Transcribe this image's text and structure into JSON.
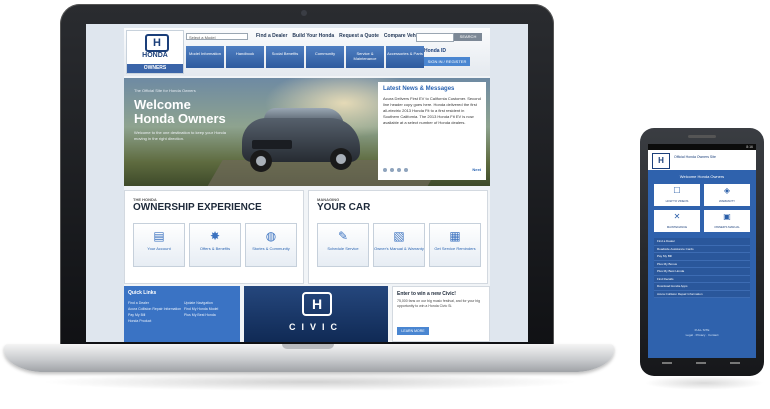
{
  "site": {
    "brand": "HONDA",
    "brand_sub": "OWNERS",
    "selector": "Select a Model",
    "top_links": [
      "Find a Dealer",
      "Build Your Honda",
      "Request a Quote",
      "Compare Vehicles"
    ],
    "search_button": "SEARCH",
    "nav": [
      "Model Information",
      "Handbook",
      "Social Benefits",
      "Community",
      "Service & Maintenance",
      "Accessories & Parts"
    ],
    "honda_id": "Honda ID",
    "register": "SIGN IN / REGISTER",
    "hero": {
      "eyebrow": "The Official Site for Honda Owners",
      "title": "Welcome Honda Owners",
      "desc": "Welcome to the one destination to keep your Honda moving in the right direction."
    },
    "news": {
      "title": "Latest News & Messages",
      "body": "Acura Delivers First EV to California Customer. Second line header copy goes here. Honda delivered the first all-electric 2013 Honda Fit to a first resident in Southern California. The 2013 Honda Fit EV is now available at a select number of Honda dealers.",
      "next": "Next"
    },
    "ownership": {
      "small": "THE HONDA",
      "big": "OWNERSHIP EXPERIENCE",
      "tiles": [
        {
          "icon": "folder-icon",
          "glyph": "▤",
          "label": "Your Account"
        },
        {
          "icon": "sparkle-icon",
          "glyph": "✸",
          "label": "Offers & Benefits"
        },
        {
          "icon": "globe-icon",
          "glyph": "◍",
          "label": "Stories & Community"
        }
      ]
    },
    "managing": {
      "small": "MANAGING",
      "big": "YOUR CAR",
      "tiles": [
        {
          "icon": "wrench-icon",
          "glyph": "✎",
          "label": "Schedule Service"
        },
        {
          "icon": "manual-icon",
          "glyph": "▧",
          "label": "Owner's Manual & Warranty"
        },
        {
          "icon": "calendar-icon",
          "glyph": "▦",
          "label": "Get Service Reminders"
        }
      ]
    },
    "quick": {
      "title": "Quick Links",
      "col1": [
        "Find a Dealer",
        "Acura Collision Repair Information",
        "Pay My Bill",
        "Honda Product"
      ],
      "col2": [
        "Update Navigation",
        "Find My Honda Model",
        "Plus My Best Honda"
      ]
    },
    "civic_word": "CIVIC",
    "enter": {
      "title": "Enter to win a new Civic!",
      "body": "75,000 fans on our big music festival, and for your big opportunity to win a Honda Civic Si.",
      "button": "LEARN MORE"
    }
  },
  "phone": {
    "status_time": "8:16",
    "header": "Official Honda Owners Site",
    "welcome": "Welcome Honda Owners",
    "tiles": [
      {
        "icon": "gift-icon",
        "glyph": "☐",
        "label": "HOW TO VIDEOS"
      },
      {
        "icon": "shield-icon",
        "glyph": "◈",
        "label": "WARRANTY"
      },
      {
        "icon": "tools-icon",
        "glyph": "✕",
        "label": "MAINTENANCE"
      },
      {
        "icon": "book-icon",
        "glyph": "▣",
        "label": "OWNER'S MANUAL"
      }
    ],
    "list": [
      "Find a Dealer",
      "Roadside Assistance Cards",
      "Pay My Bill",
      "Plus My Bonus",
      "Plus My Best Honda",
      "Find Recalls",
      "Download Honda Apps",
      "Acura Collision Repair Information"
    ],
    "footer": [
      "FULL SITE",
      "Legal · Privacy · Contact"
    ]
  }
}
